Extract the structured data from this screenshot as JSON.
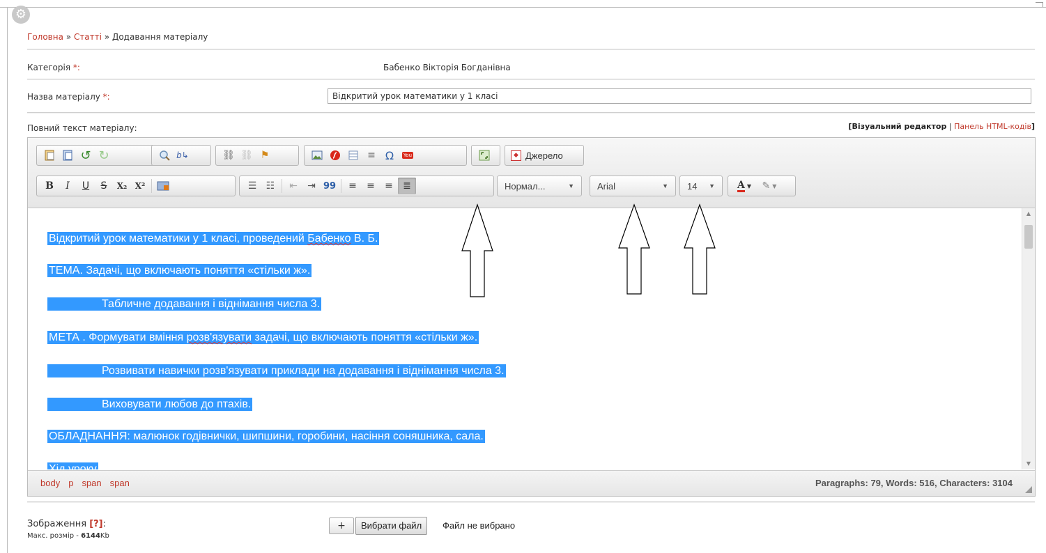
{
  "breadcrumb": {
    "home": "Головна",
    "sep1": " » ",
    "articles": "Статті",
    "sep2": " » ",
    "current": "Додавання матеріалу"
  },
  "category": {
    "label": "Категорія",
    "required": " *:",
    "value": "Бабенко Вікторія Богданівна"
  },
  "material_title": {
    "label": "Назва матеріалу",
    "required": " *:",
    "value": "Відкритий урок математики у 1 класі"
  },
  "fulltext": {
    "label": "Повний текст матеріалу:"
  },
  "editor_mode": {
    "open_bracket": "[",
    "visual": "Візуальний редактор",
    "divider": " | ",
    "html_panel": "Панель HTML-кодів",
    "close_bracket": "]"
  },
  "toolbar": {
    "source_label": "Джерело",
    "format_value": "Нормал...",
    "font_value": "Arial",
    "size_value": "14",
    "bold": "B",
    "italic": "I",
    "underline": "U",
    "strike": "S",
    "subscript": "X₂",
    "superscript": "X²",
    "quote": "99",
    "omega": "Ω",
    "youtube": "You"
  },
  "content": {
    "paragraphs": [
      {
        "text": "Відкритий урок математики у 1 класі, проведений ",
        "misspelled": "Бабенко",
        "tail": " В. Б."
      },
      {
        "text": "ТЕМА. Задачі, що включають поняття «стільки ж»."
      },
      {
        "text": "Табличне додавання і віднімання числа 3."
      },
      {
        "text": "МЕТА . Формувати вміння ",
        "misspelled": "розв'язувати",
        "tail": " задачі, що включають поняття «стільки ж»."
      },
      {
        "text": "Розвивати навички розв'язувати приклади на додавання і віднімання числа 3."
      },
      {
        "text": "Виховувати любов до птахів."
      },
      {
        "text": "ОБЛАДНАННЯ: малюнок годівнички, шипшини, горобини, насіння соняшника, сала."
      },
      {
        "text": "Хід уроку"
      }
    ]
  },
  "statusbar": {
    "path": [
      "body",
      "p",
      "span",
      "span"
    ],
    "counts": "Paragraphs: 79, Words: 516, Characters: 3104"
  },
  "image_upload": {
    "label": "Зображення",
    "help": "[?]",
    "colon": ":",
    "max_label": "Макс. розмір - ",
    "max_value": "6144",
    "max_unit": "Kb",
    "plus": "+",
    "choose_file": "Вибрати файл",
    "no_file": "Файл не вибрано"
  },
  "colors": {
    "link": "#c0392b",
    "highlight": "#3399ff"
  }
}
